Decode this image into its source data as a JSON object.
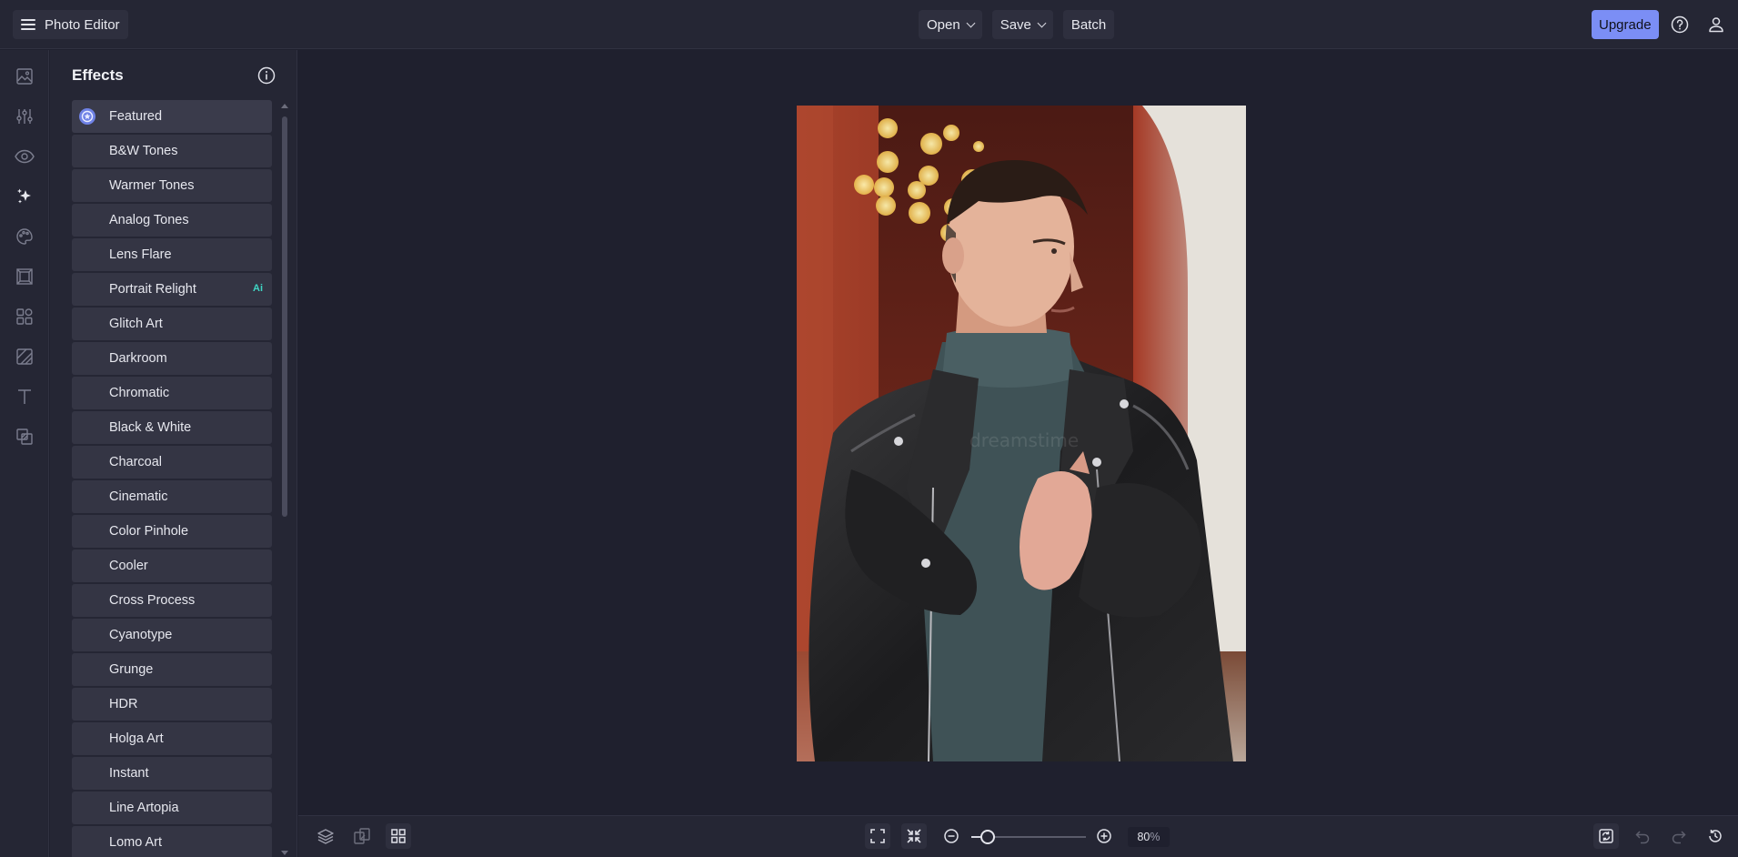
{
  "app": {
    "title": "Photo Editor"
  },
  "topbar": {
    "open_label": "Open",
    "save_label": "Save",
    "batch_label": "Batch",
    "upgrade_label": "Upgrade",
    "icons": [
      "menu-icon",
      "help-icon",
      "account-icon"
    ]
  },
  "rail": {
    "icons": [
      "image-icon",
      "adjust-sliders-icon",
      "eye-icon",
      "effects-sparkle-icon",
      "palette-icon",
      "frame-icon",
      "shapes-icon",
      "texture-icon",
      "text-icon",
      "overlay-icon"
    ],
    "active": "effects-sparkle-icon"
  },
  "panel": {
    "title": "Effects",
    "items": [
      {
        "label": "Featured",
        "badge": ""
      },
      {
        "label": "B&W Tones",
        "badge": ""
      },
      {
        "label": "Warmer Tones",
        "badge": ""
      },
      {
        "label": "Analog Tones",
        "badge": ""
      },
      {
        "label": "Lens Flare",
        "badge": ""
      },
      {
        "label": "Portrait Relight",
        "badge": "Ai"
      },
      {
        "label": "Glitch Art",
        "badge": ""
      },
      {
        "label": "Darkroom",
        "badge": ""
      },
      {
        "label": "Chromatic",
        "badge": ""
      },
      {
        "label": "Black & White",
        "badge": ""
      },
      {
        "label": "Charcoal",
        "badge": ""
      },
      {
        "label": "Cinematic",
        "badge": ""
      },
      {
        "label": "Color Pinhole",
        "badge": ""
      },
      {
        "label": "Cooler",
        "badge": ""
      },
      {
        "label": "Cross Process",
        "badge": ""
      },
      {
        "label": "Cyanotype",
        "badge": ""
      },
      {
        "label": "Grunge",
        "badge": ""
      },
      {
        "label": "HDR",
        "badge": ""
      },
      {
        "label": "Holga Art",
        "badge": ""
      },
      {
        "label": "Instant",
        "badge": ""
      },
      {
        "label": "Line Artopia",
        "badge": ""
      },
      {
        "label": "Lomo Art",
        "badge": ""
      }
    ]
  },
  "bottombar": {
    "zoom_value": "80",
    "zoom_unit": "%",
    "zoom_fraction": 0.14,
    "icons": [
      "layers-icon",
      "compare-icon",
      "grid-icon",
      "fit-screen-icon",
      "actual-size-icon",
      "zoom-out-icon",
      "zoom-in-icon",
      "sync-icon",
      "undo-icon",
      "redo-icon",
      "history-icon"
    ]
  },
  "colors": {
    "accent": "#7b8ef5",
    "ai_badge": "#3fd6c4",
    "background": "#1f202e",
    "panel": "#252634"
  }
}
